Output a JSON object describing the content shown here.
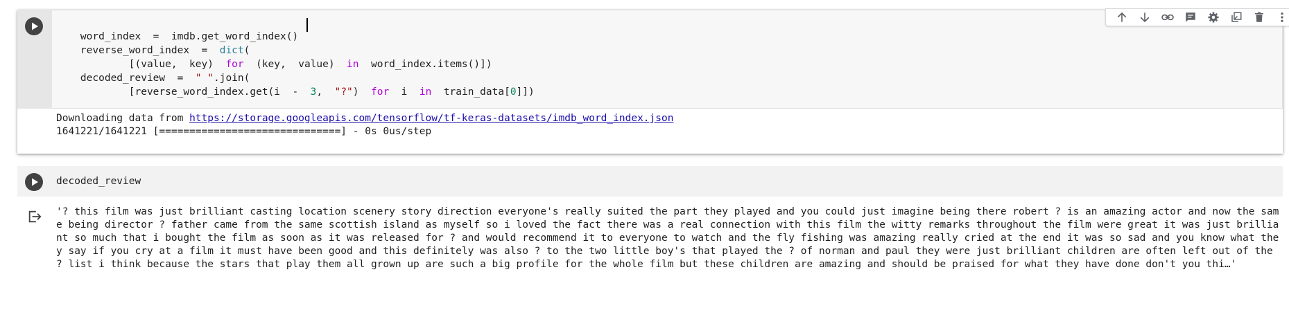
{
  "toolbar": {
    "icons": [
      "arrow-up-icon",
      "arrow-down-icon",
      "link-icon",
      "comment-icon",
      "gear-icon",
      "mirror-cell-icon",
      "trash-icon",
      "more-vert-icon"
    ]
  },
  "cell1": {
    "code": {
      "l1_a": "word_index  =  imdb.get_word_index()",
      "l2_a": "reverse_word_index  =  ",
      "l2_b": "dict",
      "l2_c": "(",
      "l3_a": "        [(value,  key)  ",
      "l3_b": "for",
      "l3_c": "  (key,  value)  ",
      "l3_d": "in",
      "l3_e": "  word_index.items()])",
      "l4_a": "decoded_review  =  ",
      "l4_b": "\" \"",
      "l4_c": ".join(",
      "l5_a": "        [reverse_word_index.get(i  -  ",
      "l5_b": "3",
      "l5_c": ",  ",
      "l5_d": "\"?\"",
      "l5_e": ")  ",
      "l5_f": "for",
      "l5_g": "  i  ",
      "l5_h": "in",
      "l5_i": "  train_data[",
      "l5_j": "0",
      "l5_k": "]])"
    },
    "output": {
      "download_prefix": "Downloading data from ",
      "download_url": "https://storage.googleapis.com/tensorflow/tf-keras-datasets/imdb_word_index.json",
      "progress": "1641221/1641221 [==============================] - 0s 0us/step"
    }
  },
  "cell2": {
    "code": "decoded_review",
    "output": "'? this film was just brilliant casting location scenery story direction everyone's really suited the part they played and you could just imagine being there robert ? is an amazing actor and now the same being director ? father came from the same scottish island as myself so i loved the fact there was a real connection with this film the witty remarks throughout the film were great it was just brilliant so much that i bought the film as soon as it was released for ? and would recommend it to everyone to watch and the fly fishing was amazing really cried at the end it was so sad and you know what they say if you cry at a film it must have been good and this definitely was also ? to the two little boy's that played the ? of norman and paul they were just brilliant children are often left out of the ? list i think because the stars that play them all grown up are such a big profile for the whole film but these children are amazing and should be praised for what they have done don't you thi…'"
  }
}
